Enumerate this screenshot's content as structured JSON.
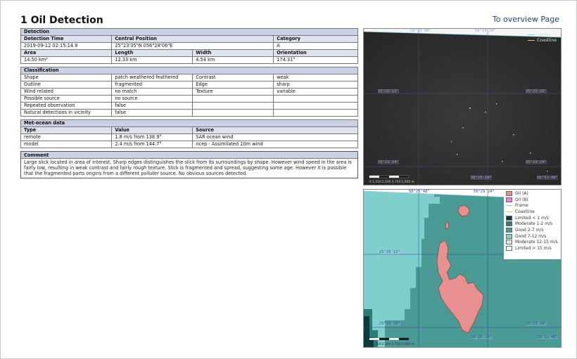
{
  "page": {
    "title": "1 Oil Detection",
    "overview_link": "To overview Page"
  },
  "detection": {
    "header": "Detection",
    "col_labels": [
      "Detection Time",
      "Central Position",
      "Category"
    ],
    "values": [
      "2019-09-12 02:15:14.9",
      "25°23'35\"N 056°28'06\"E",
      "A"
    ],
    "col_labels2": [
      "Area",
      "Length",
      "Width",
      "Orientation"
    ],
    "values2": [
      "14.50 km²",
      "12.33 km",
      "4.54 km",
      "174.31°"
    ]
  },
  "classification": {
    "header": "Classification",
    "rows": [
      [
        "Shape",
        "patch weathered feathered",
        "Contrast",
        "weak"
      ],
      [
        "Outline",
        "fragmented",
        "Edge",
        "sharp"
      ],
      [
        "Wind related",
        "no match",
        "Texture",
        "variable"
      ],
      [
        "Possible source",
        "no source",
        "",
        ""
      ],
      [
        "Repeated observation",
        "false",
        "",
        ""
      ],
      [
        "Natural detections in vicinity",
        "false",
        "",
        ""
      ]
    ]
  },
  "metocean": {
    "header": "Met-ocean data",
    "col_labels": [
      "Type",
      "Value",
      "Source"
    ],
    "rows": [
      [
        "remote",
        "1.8 m/s from 138.9°",
        "SAR ocean wind"
      ],
      [
        "model",
        "2.4 m/s from 144.7°",
        "ncep - Assimilated 10m wind"
      ]
    ]
  },
  "comment": {
    "header": "Comment",
    "text": "Large slick located in area of interest. Sharp edges distinguishes the slick from its surroundings by shape. However wind speed in the area is fairly low, resulting in weak contrast and fairly rough texture. Slick is fragmented and spread, suggesting some age. However it is possible that the fragmented parts origins from a different polluter source. No obvious sources detected."
  },
  "sar_image": {
    "legend": [
      "Frame",
      "Coastline"
    ],
    "legend_colors": [
      "#7fd3e6",
      "#e8c060"
    ],
    "grid_labels": {
      "top_a": "56°25'48\"",
      "top_b": "56°29'24\"",
      "mid_left": "25°25'12\"",
      "mid_right": "25°25'12\"",
      "bot_left": "25°23'24\"",
      "bot_right": "25°23'24\"",
      "bottom_a": "56°29'24\"",
      "bottom_b": "56°31'48\""
    },
    "scale_ticks": [
      "0",
      "1,250",
      "2,500",
      "3,750",
      "5,000 m"
    ]
  },
  "map_image": {
    "legend": [
      {
        "label": "Oil (A)",
        "color": "#e89090",
        "kind": "box"
      },
      {
        "label": "Oil (B)",
        "color": "#f080e0",
        "kind": "box"
      },
      {
        "label": "Frame",
        "color": "#7fd3e6",
        "kind": "line"
      },
      {
        "label": "Coastline",
        "color": "#e8c060",
        "kind": "line"
      },
      {
        "label": "Limited < 1 m/s",
        "color": "#0b3b3c",
        "kind": "box"
      },
      {
        "label": "Moderate 1-2 m/s",
        "color": "#2f7a77",
        "kind": "box"
      },
      {
        "label": "Good 2-7 m/s",
        "color": "#4a9a95",
        "kind": "box"
      },
      {
        "label": "Good 7-12 m/s",
        "color": "#7fd0cc",
        "kind": "box"
      },
      {
        "label": "Moderate 12-15 m/s",
        "color": "#c9ede9",
        "kind": "box"
      },
      {
        "label": "Limited > 15 m/s",
        "color": "#f3fbfa",
        "kind": "box"
      }
    ],
    "grid_labels": {
      "top_a": "56°25'48\"",
      "top_b": "56°29'24\"",
      "mid_left": "25°25'12\"",
      "bot_left": "25°23'24\"",
      "bot_right": "25°23'24\"",
      "bottom_a": "56°29'24\"",
      "bottom_b": "56°31'48\""
    },
    "scale_ticks": [
      "0",
      "1,250",
      "2,500",
      "3,750",
      "5,000 m"
    ]
  }
}
